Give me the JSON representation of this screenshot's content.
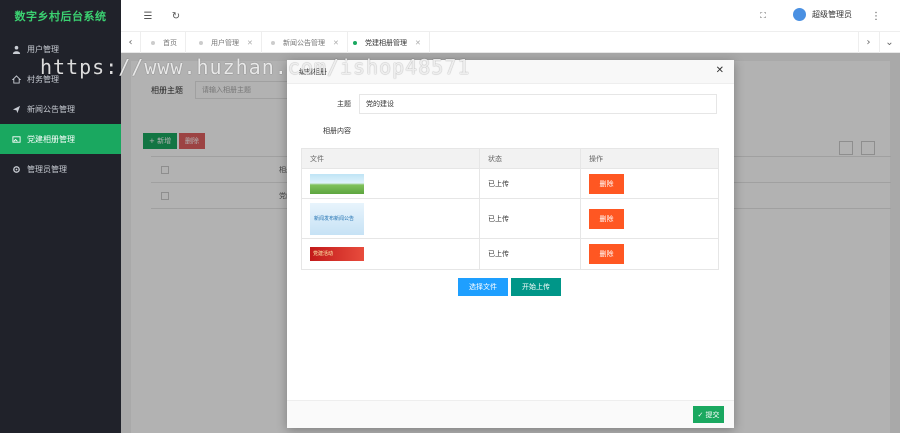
{
  "app": {
    "brand": "数字乡村后台系统"
  },
  "sidebar": {
    "items": [
      {
        "label": "用户管理",
        "icon": "user-icon",
        "active": false
      },
      {
        "label": "村务管理",
        "icon": "home-icon",
        "active": false
      },
      {
        "label": "新闻公告管理",
        "icon": "send-icon",
        "active": false
      },
      {
        "label": "党建相册管理",
        "icon": "picture-icon",
        "active": true
      },
      {
        "label": "管理员管理",
        "icon": "gear-icon",
        "active": false
      }
    ]
  },
  "header": {
    "user_name": "超级管理员"
  },
  "tabs": [
    {
      "label": "首页",
      "active": false
    },
    {
      "label": "用户管理",
      "active": false
    },
    {
      "label": "新闻公告管理",
      "active": false
    },
    {
      "label": "党建相册管理",
      "active": true
    }
  ],
  "background_page": {
    "search_label": "相册主题",
    "search_placeholder": "请输入相册主题",
    "add_button": "+ 新增",
    "delete_button": "删除",
    "table_header": "相册主",
    "table_row": "党的奋"
  },
  "modal": {
    "title": "编辑相册",
    "subject_label": "主题",
    "subject_value": "党的建设",
    "content_label": "相册内容",
    "columns": [
      "文件",
      "状态",
      "操作"
    ],
    "files": [
      {
        "status": "已上传",
        "action": "删除"
      },
      {
        "status": "已上传",
        "action": "删除",
        "thumb_text": "新闻发布新闻公告"
      },
      {
        "status": "已上传",
        "action": "删除",
        "thumb_text": "党建活动"
      }
    ],
    "choose_button": "选择文件",
    "upload_button": "开始上传",
    "submit_button": "✓ 提交"
  },
  "watermark": "https://www.huzhan.com/ishop48571",
  "colors": {
    "accent": "#1aa860",
    "danger": "#ff5722",
    "blue": "#1e9fff",
    "teal": "#009688"
  }
}
